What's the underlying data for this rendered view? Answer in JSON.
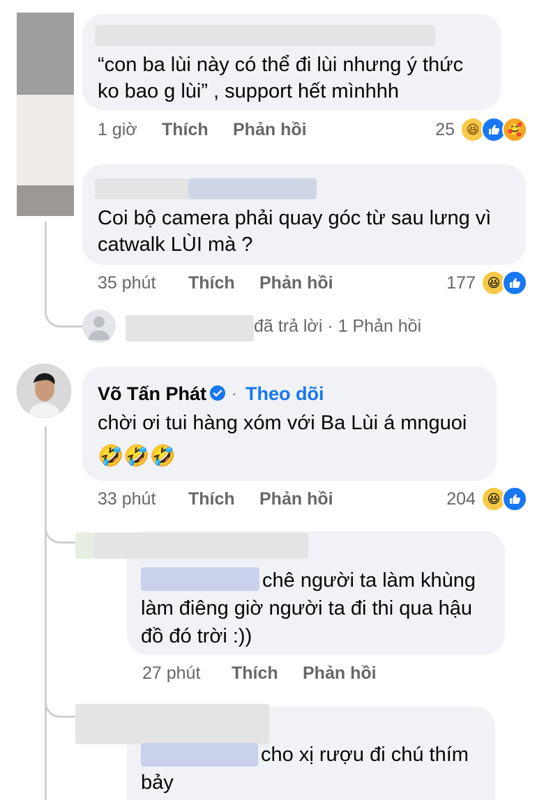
{
  "comment1": {
    "text_line1": "“con ba lùi này có thể đi lùi nhưng ý thức",
    "text_line2": "ko bao g lùi” , support hết mìnhhh",
    "time": "1 giờ",
    "like_label": "Thích",
    "reply_label": "Phản hồi",
    "reaction_count": "25",
    "reactions": [
      "haha-icon",
      "like-icon",
      "care-icon"
    ]
  },
  "comment2": {
    "text_line1": "Coi bộ camera phải quay góc từ sau lưng vì",
    "text_line2": "catwalk LÙI mà ?",
    "time": "35 phút",
    "like_label": "Thích",
    "reply_label": "Phản hồi",
    "reaction_count": "177",
    "reactions": [
      "haha-icon",
      "like-icon"
    ]
  },
  "replies_summary": {
    "text": "đã trả lời · 1 Phản hồi"
  },
  "comment3": {
    "author": "Võ Tấn Phát",
    "follow_label": "Theo dõi",
    "separator": "·",
    "text_line1": "chời ơi tui hàng xóm với Ba Lùi á mnguoi",
    "emoji_line": "🤣🤣🤣",
    "time": "33 phút",
    "like_label": "Thích",
    "reply_label": "Phản hồi",
    "reaction_count": "204",
    "reactions": [
      "haha-icon",
      "like-icon"
    ]
  },
  "reply1": {
    "text_line1": "chê người ta làm khùng",
    "text_line2": "làm điêng giờ người ta đi thi qua hậu",
    "text_line3": "đồ đó trời :))",
    "time": "27 phút",
    "like_label": "Thích",
    "reply_label": "Phản hồi"
  },
  "reply2": {
    "text_line1": "cho xị rượu đi chú thím",
    "text_line2": "bảy"
  },
  "colors": {
    "bubble": "#f0f2f5",
    "meta_gray": "#65676b",
    "link_blue": "#1877f2",
    "verified_blue": "#1877f2"
  }
}
